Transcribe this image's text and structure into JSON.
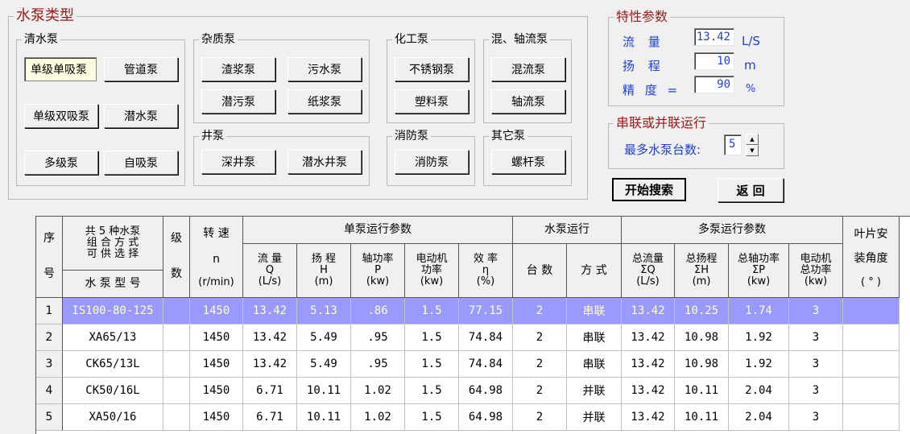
{
  "pump_type": {
    "title": "水泵类型",
    "clear_water": {
      "title": "清水泵",
      "buttons": [
        "单级单吸泵",
        "管道泵",
        "单级双吸泵",
        "潜水泵",
        "多级泵",
        "自吸泵"
      ]
    },
    "impurity": {
      "title": "杂质泵",
      "buttons": [
        "渣浆泵",
        "污水泵",
        "潜污泵",
        "纸浆泵"
      ]
    },
    "chemical": {
      "title": "化工泵",
      "buttons": [
        "不锈钢泵",
        "塑料泵"
      ]
    },
    "mixed_axial": {
      "title": "混、轴流泵",
      "buttons": [
        "混流泵",
        "轴流泵"
      ]
    },
    "well": {
      "title": "井泵",
      "buttons": [
        "深井泵",
        "潜水井泵"
      ]
    },
    "fire": {
      "title": "消防泵",
      "buttons": [
        "消防泵"
      ]
    },
    "other": {
      "title": "其它泵",
      "buttons": [
        "螺杆泵"
      ]
    }
  },
  "params": {
    "title": "特性参数",
    "flow_label": "流 量",
    "flow_value": "13.42",
    "flow_unit": "L/S",
    "head_label": "扬 程",
    "head_value": "10",
    "head_unit": "m",
    "precision_label": "精 度 =",
    "precision_value": "90",
    "precision_unit": "%"
  },
  "series": {
    "title": "串联或并联运行",
    "max_label": "最多水泵台数:",
    "max_value": "5"
  },
  "actions": {
    "search": "开始搜索",
    "back": "返 回"
  },
  "table": {
    "hdr": {
      "seq_a": "序",
      "seq_b": "号",
      "combo_1": "共 5 种水泵",
      "combo_2": "组 合 方 式",
      "combo_3": "可 供 选 择",
      "model": "水 泵 型 号",
      "stage_a": "级",
      "stage_b": "数",
      "speed_1": "转 速",
      "speed_2": "n",
      "speed_3": "(r/min)",
      "single": "单泵运行参数",
      "q_1": "流 量",
      "q_2": "Q",
      "q_3": "(L/s)",
      "h_1": "扬 程",
      "h_2": "H",
      "h_3": "(m)",
      "p_1": "轴功率",
      "p_2": "P",
      "p_3": "(kw)",
      "m_1": "电动机",
      "m_2": "功率",
      "m_3": "(kw)",
      "e_1": "效 率",
      "e_2": "η",
      "e_3": "(%)",
      "run": "水泵运行",
      "count": "台 数",
      "mode": "方 式",
      "multi": "多泵运行参数",
      "tq_1": "总流量",
      "tq_2": "ΣQ",
      "tq_3": "(L/s)",
      "th_1": "总扬程",
      "th_2": "ΣH",
      "th_3": "(m)",
      "tp_1": "总轴功率",
      "tp_2": "ΣP",
      "tp_3": "(kw)",
      "tm_1": "电动机",
      "tm_2": "总功率",
      "tm_3": "(kw)",
      "blade_1": "叶片安",
      "blade_2": "装角度",
      "blade_3": "( ° )"
    },
    "rows": [
      [
        "1",
        "IS100-80-125",
        "",
        "1450",
        "13.42",
        "5.13",
        ".86",
        "1.5",
        "77.15",
        "2",
        "串联",
        "13.42",
        "10.25",
        "1.74",
        "3",
        ""
      ],
      [
        "2",
        "XA65/13",
        "",
        "1450",
        "13.42",
        "5.49",
        ".95",
        "1.5",
        "74.84",
        "2",
        "串联",
        "13.42",
        "10.98",
        "1.92",
        "3",
        ""
      ],
      [
        "3",
        "CK65/13L",
        "",
        "1450",
        "13.42",
        "5.49",
        ".95",
        "1.5",
        "74.84",
        "2",
        "串联",
        "13.42",
        "10.98",
        "1.92",
        "3",
        ""
      ],
      [
        "4",
        "CK50/16L",
        "",
        "1450",
        "6.71",
        "10.11",
        "1.02",
        "1.5",
        "64.98",
        "2",
        "并联",
        "13.42",
        "10.11",
        "2.04",
        "3",
        ""
      ],
      [
        "5",
        "XA50/16",
        "",
        "1450",
        "6.71",
        "10.11",
        "1.02",
        "1.5",
        "64.98",
        "2",
        "并联",
        "13.42",
        "10.11",
        "2.04",
        "3",
        ""
      ]
    ]
  }
}
